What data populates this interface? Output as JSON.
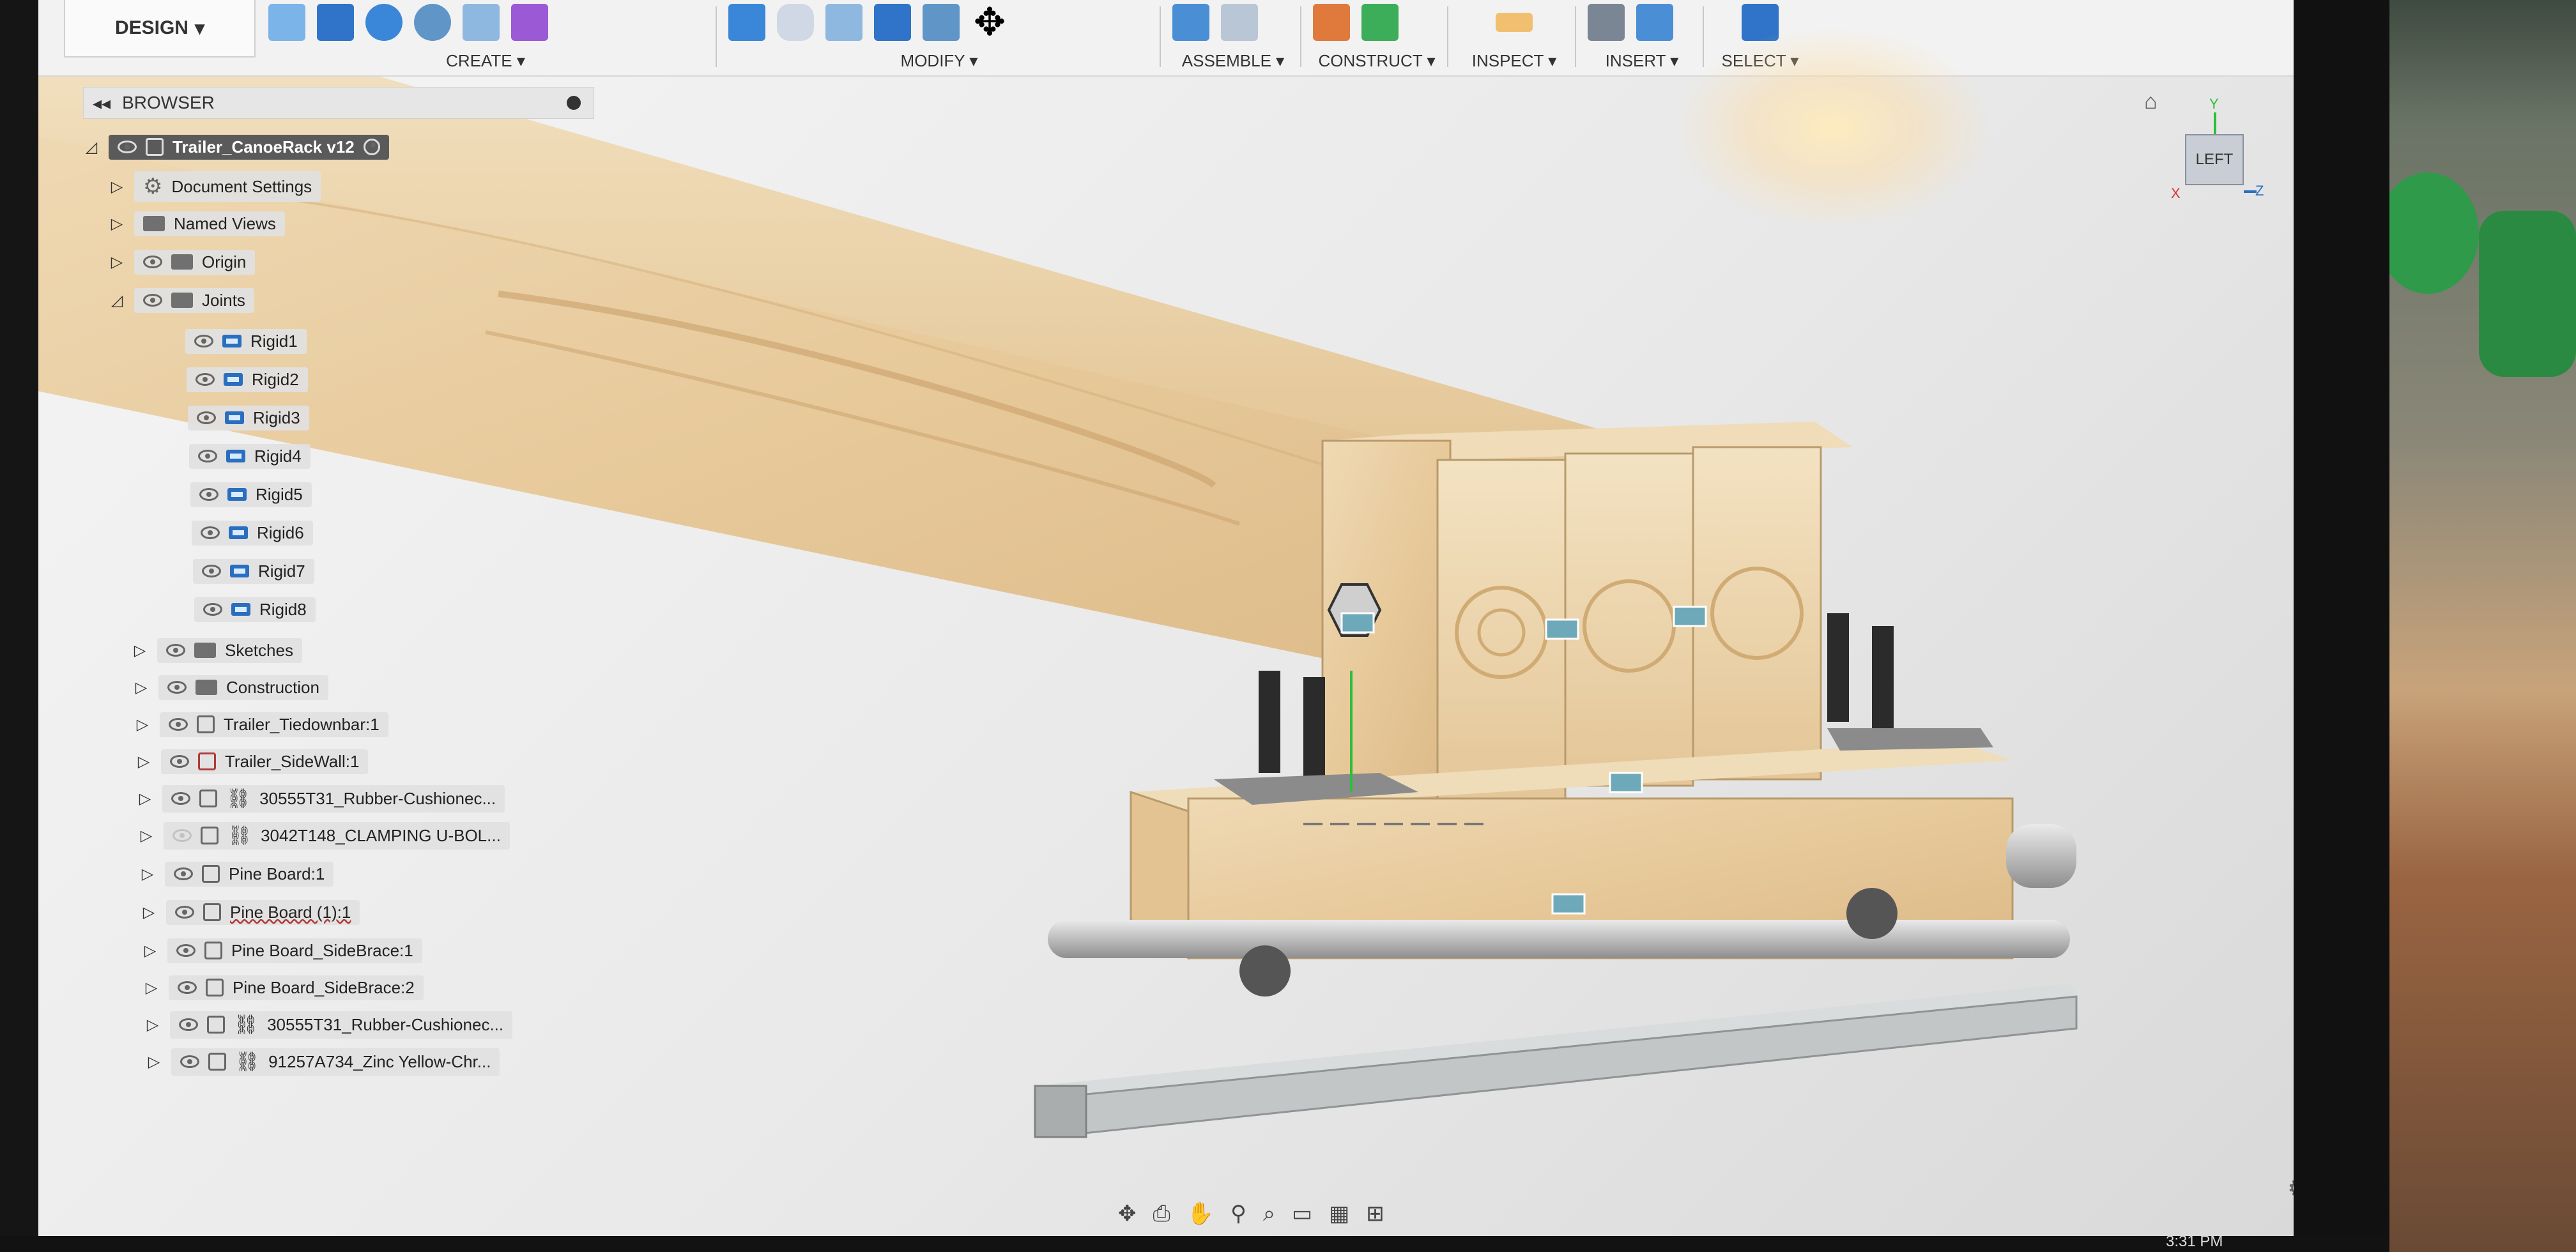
{
  "toolbar": {
    "workspace": "DESIGN",
    "groups": [
      {
        "label": "CREATE ▾"
      },
      {
        "label": "MODIFY ▾"
      },
      {
        "label": "ASSEMBLE ▾"
      },
      {
        "label": "CONSTRUCT ▾"
      },
      {
        "label": "INSPECT ▾"
      },
      {
        "label": "INSERT ▾"
      },
      {
        "label": "SELECT ▾"
      }
    ]
  },
  "browser": {
    "title": "BROWSER",
    "root": "Trailer_CanoeRack v12",
    "items": [
      {
        "label": "Document Settings"
      },
      {
        "label": "Named Views"
      },
      {
        "label": "Origin"
      },
      {
        "label": "Joints"
      },
      {
        "label": "Rigid1"
      },
      {
        "label": "Rigid2"
      },
      {
        "label": "Rigid3"
      },
      {
        "label": "Rigid4"
      },
      {
        "label": "Rigid5"
      },
      {
        "label": "Rigid6"
      },
      {
        "label": "Rigid7"
      },
      {
        "label": "Rigid8"
      },
      {
        "label": "Sketches"
      },
      {
        "label": "Construction"
      },
      {
        "label": "Trailer_Tiedownbar:1"
      },
      {
        "label": "Trailer_SideWall:1"
      },
      {
        "label": "30555T31_Rubber-Cushionec..."
      },
      {
        "label": "3042T148_CLAMPING U-BOL..."
      },
      {
        "label": "Pine Board:1"
      },
      {
        "label": "Pine Board (1):1"
      },
      {
        "label": "Pine Board_SideBrace:1"
      },
      {
        "label": "Pine Board_SideBrace:2"
      },
      {
        "label": "30555T31_Rubber-Cushionec..."
      },
      {
        "label": "91257A734_Zinc Yellow-Chr..."
      }
    ]
  },
  "viewcube": {
    "face": "LEFT",
    "axis_y": "Y",
    "axis_z": "Z",
    "axis_x": "X"
  },
  "taskbar": {
    "time": "3:31 PM"
  },
  "icons": {
    "home": "home-icon",
    "settings": "gear-icon",
    "collapse": "double-chevron-left-icon"
  }
}
